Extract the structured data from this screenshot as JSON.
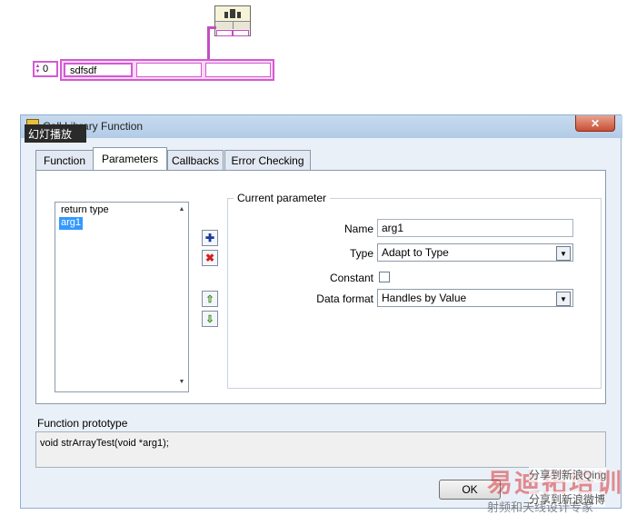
{
  "diagram": {
    "array_index": "0",
    "array_element_0": "sdfsdf"
  },
  "dialog": {
    "title": "Call Library Function",
    "overlay_label": "幻灯播放",
    "tabs": [
      {
        "label": "Function"
      },
      {
        "label": "Parameters"
      },
      {
        "label": "Callbacks"
      },
      {
        "label": "Error Checking"
      }
    ],
    "parameter_list": [
      "return type",
      "arg1"
    ],
    "current_parameter": {
      "legend": "Current parameter",
      "name_label": "Name",
      "name_value": "arg1",
      "type_label": "Type",
      "type_value": "Adapt to Type",
      "constant_label": "Constant",
      "data_format_label": "Data format",
      "data_format_value": "Handles by Value"
    },
    "prototype_label": "Function prototype",
    "prototype_value": "void  strArrayTest(void *arg1);",
    "ok_label": "OK",
    "close_glyph": "✕"
  },
  "watermark": {
    "share1": "分享到新浪Qing",
    "share2": "分享到新浪微博",
    "logo": "易迪拓培训",
    "text": "射频和天线设计专家"
  }
}
